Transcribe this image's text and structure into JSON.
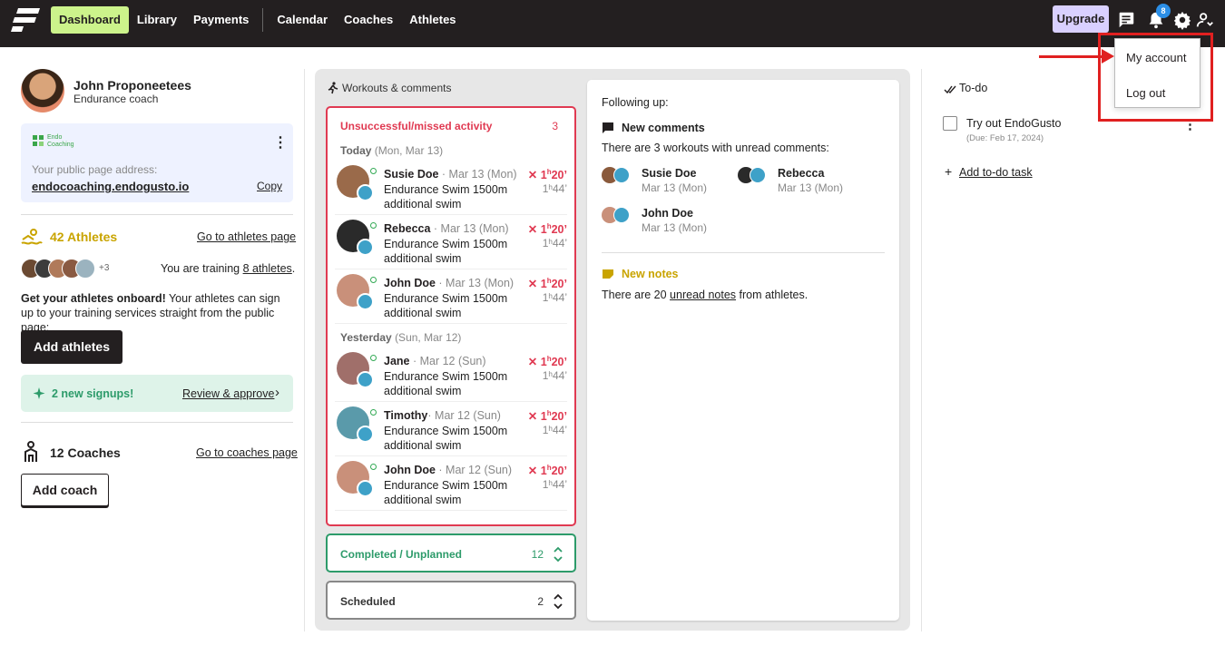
{
  "nav": {
    "items": [
      {
        "label": "Dashboard",
        "active": true
      },
      {
        "label": "Library"
      },
      {
        "label": "Payments"
      },
      {
        "label": "Calendar"
      },
      {
        "label": "Coaches"
      },
      {
        "label": "Athletes"
      }
    ],
    "upgrade_label": "Upgrade",
    "notification_count": "8",
    "icons": [
      "chat-icon",
      "bell-icon",
      "gear-icon",
      "user-menu-icon"
    ]
  },
  "account_menu": {
    "items": [
      "My account",
      "Log out"
    ]
  },
  "profile": {
    "name": "John Proponeetees",
    "role": "Endurance coach",
    "brand_logo_text": "Endo Coaching",
    "public_page_label": "Your public page address:",
    "public_page_url": "endocoaching.endogusto.io",
    "copy_label": "Copy"
  },
  "athletes": {
    "count_label": "42 Athletes",
    "go_link": "Go to athletes page",
    "more_count": "+3",
    "training_prefix": "You are training ",
    "training_link": "8 athletes",
    "training_suffix": ".",
    "onboard_bold": "Get your athletes onboard!",
    "onboard_text": " Your athletes can sign up to your training services straight from the public page:",
    "add_button": "Add athletes",
    "signups_label": "2 new signups!",
    "review_link": "Review & approve",
    "review_chevron": "›"
  },
  "coaches": {
    "count_label": "12 Coaches",
    "go_link": "Go to coaches page",
    "add_button": "Add coach"
  },
  "workouts": {
    "section_title": "Workouts & comments",
    "missed": {
      "title": "Unsuccessful/missed activity",
      "count": "3",
      "groups": [
        {
          "day": "Today",
          "date": "(Mon, Mar 13)",
          "rows": [
            {
              "name": "Susie Doe",
              "date": " · Mar 13 (Mon)",
              "activity": "Endurance Swim 1500m additional swim",
              "x": "✕",
              "h": "1",
              "hu": "h",
              "m": "20’",
              "planned": "1ʰ44’"
            },
            {
              "name": "Rebecca",
              "date": " · Mar 13 (Mon)",
              "activity": "Endurance Swim 1500m additional swim",
              "x": "✕",
              "h": "1",
              "hu": "h",
              "m": "20’",
              "planned": "1ʰ44’"
            },
            {
              "name": "John Doe",
              "date": " · Mar 13 (Mon)",
              "activity": "Endurance Swim 1500m additional swim",
              "x": "✕",
              "h": "1",
              "hu": "h",
              "m": "20’",
              "planned": "1ʰ44’"
            }
          ]
        },
        {
          "day": "Yesterday",
          "date": "(Sun, Mar 12)",
          "rows": [
            {
              "name": "Jane",
              "date": " · Mar 12 (Sun)",
              "activity": "Endurance Swim 1500m additional swim",
              "x": "✕",
              "h": "1",
              "hu": "h",
              "m": "20’",
              "planned": "1ʰ44’"
            },
            {
              "name": "Timothy",
              "date": "· Mar 12 (Sun)",
              "activity": "Endurance Swim 1500m additional swim",
              "x": "✕",
              "h": "1",
              "hu": "h",
              "m": "20’",
              "planned": "1ʰ44’"
            },
            {
              "name": "John Doe",
              "date": " · Mar 12 (Sun)",
              "activity": "Endurance Swim 1500m additional swim",
              "x": "✕",
              "h": "1",
              "hu": "h",
              "m": "20’",
              "planned": "1ʰ44’"
            }
          ]
        }
      ]
    },
    "completed": {
      "title": "Completed / Unplanned",
      "count": "12",
      "chevrons": "⌃⌄"
    },
    "scheduled": {
      "title": "Scheduled",
      "count": "2",
      "chevrons": "⌃⌄"
    }
  },
  "following": {
    "title": "Following up:",
    "comments_title": "New comments",
    "comments_text": "There are 3 workouts with unread comments:",
    "comment_people": [
      {
        "name": "Susie Doe",
        "date": "Mar 13 (Mon)"
      },
      {
        "name": "Rebecca",
        "date": "Mar 13 (Mon)"
      },
      {
        "name": "John Doe",
        "date": "Mar 13 (Mon)"
      }
    ],
    "notes_title": "New notes",
    "notes_prefix": "There are 20 ",
    "notes_link": "unread notes",
    "notes_suffix": " from athletes."
  },
  "todo": {
    "title": "To-do",
    "items": [
      {
        "label": "Try out EndoGusto",
        "due": "(Due: Feb 17, 2024)"
      }
    ],
    "add_label": "Add to-do task",
    "add_plus": "+",
    "menu_glyph": "⋮"
  },
  "colors": {
    "topbar": "#231f20",
    "active_nav": "#ccf38b",
    "upgrade": "#d9d0ff",
    "missed": "#e03a52",
    "completed": "#2d9b6a",
    "athletes_accent": "#c9a400",
    "annotation": "#e02020"
  }
}
